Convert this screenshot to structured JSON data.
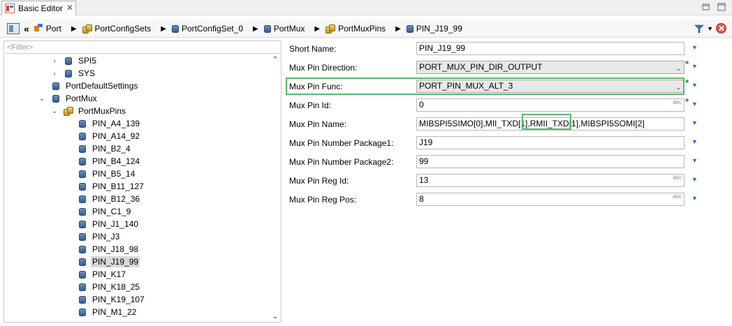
{
  "editor_tab": {
    "title": "Basic Editor",
    "close_glyph": "✕"
  },
  "breadcrumb": {
    "back_glyph": "«",
    "items": [
      {
        "label": "Port",
        "icon": "port-icon"
      },
      {
        "label": "PortConfigSets",
        "icon": "config-set-icon"
      },
      {
        "label": "PortConfigSet_0",
        "icon": "config-icon"
      },
      {
        "label": "PortMux",
        "icon": "config-icon"
      },
      {
        "label": "PortMuxPins",
        "icon": "config-set-icon"
      },
      {
        "label": "PIN_J19_99",
        "icon": "config-icon"
      }
    ]
  },
  "tree": {
    "filter_placeholder": "<Filter>",
    "items": [
      {
        "label": "SPI5",
        "twisty": "›",
        "kind": "cyl"
      },
      {
        "label": "SYS",
        "twisty": "›",
        "kind": "cyl"
      },
      {
        "label": "PortDefaultSettings",
        "twisty": "",
        "kind": "cyl"
      },
      {
        "label": "PortMux",
        "twisty": "⌄",
        "kind": "cyl"
      },
      {
        "label": "PortMuxPins",
        "twisty": "⌄",
        "kind": "stack"
      },
      {
        "label": "PIN_A4_139",
        "kind": "cyl"
      },
      {
        "label": "PIN_A14_92",
        "kind": "cyl"
      },
      {
        "label": "PIN_B2_4",
        "kind": "cyl"
      },
      {
        "label": "PIN_B4_124",
        "kind": "cyl"
      },
      {
        "label": "PIN_B5_14",
        "kind": "cyl"
      },
      {
        "label": "PIN_B11_127",
        "kind": "cyl"
      },
      {
        "label": "PIN_B12_36",
        "kind": "cyl"
      },
      {
        "label": "PIN_C1_9",
        "kind": "cyl"
      },
      {
        "label": "PIN_J1_140",
        "kind": "cyl"
      },
      {
        "label": "PIN_J3",
        "kind": "cyl"
      },
      {
        "label": "PIN_J18_98",
        "kind": "cyl"
      },
      {
        "label": "PIN_J19_99",
        "kind": "cyl",
        "selected": true
      },
      {
        "label": "PIN_K17",
        "kind": "cyl"
      },
      {
        "label": "PIN_K18_25",
        "kind": "cyl"
      },
      {
        "label": "PIN_K19_107",
        "kind": "cyl"
      },
      {
        "label": "PIN_M1_22",
        "kind": "cyl"
      }
    ]
  },
  "properties": {
    "short_name": {
      "label": "Short Name:",
      "value": "PIN_J19_99"
    },
    "mux_pin_direction": {
      "label": "Mux Pin Direction:",
      "value": "PORT_MUX_PIN_DIR_OUTPUT"
    },
    "mux_pin_func": {
      "label": "Mux Pin Func:",
      "value": "PORT_PIN_MUX_ALT_3"
    },
    "mux_pin_id": {
      "label": "Mux Pin Id:",
      "value": "0",
      "unit": "dec"
    },
    "mux_pin_name": {
      "label": "Mux Pin Name:",
      "value": "MIBSPI5SIMO[0],MII_TXD[1],RMII_TXD[1],MIBSPI5SOMI[2]"
    },
    "mux_pin_number_package1": {
      "label": "Mux Pin Number Package1:",
      "value": "J19"
    },
    "mux_pin_number_package2": {
      "label": "Mux Pin Number Package2:",
      "value": "99"
    },
    "mux_pin_reg_id": {
      "label": "Mux Pin Reg Id:",
      "value": "13",
      "unit": "dec"
    },
    "mux_pin_reg_pos": {
      "label": "Mux Pin Reg Pos:",
      "value": "8",
      "unit": "dec"
    }
  },
  "glyphs": {
    "menu": "▼",
    "combo": "⌄",
    "star": "*",
    "sep": "▶",
    "up": "⌃",
    "down": "⌄"
  },
  "colors": {
    "highlight_box": "#52bb6b",
    "modified_star": "#1d8a2e",
    "menu_arrow": "#2b6cc4"
  }
}
